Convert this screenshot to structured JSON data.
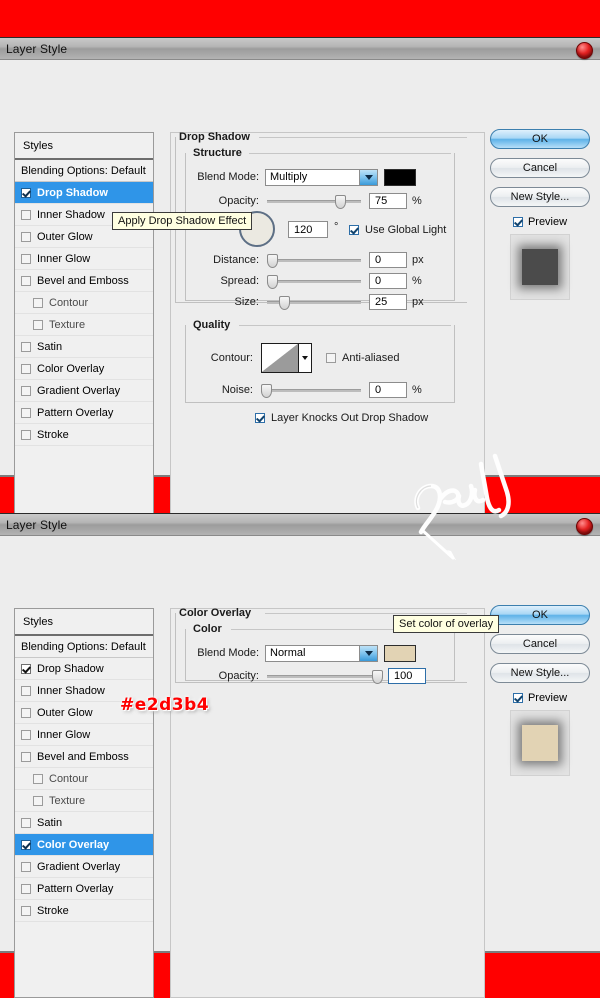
{
  "page": {
    "background_color": "#ff0000",
    "annotation_hex": "#e2d3b4",
    "signature_text": "genial"
  },
  "dialog1": {
    "title": "Layer Style",
    "styles": {
      "header": "Styles",
      "items": [
        {
          "label": "Blending Options: Default",
          "checkbox": false,
          "checked": false,
          "selected": false,
          "sub": false
        },
        {
          "label": "Drop Shadow",
          "checkbox": true,
          "checked": true,
          "selected": true,
          "sub": false
        },
        {
          "label": "Inner Shadow",
          "checkbox": true,
          "checked": false,
          "selected": false,
          "sub": false
        },
        {
          "label": "Outer Glow",
          "checkbox": true,
          "checked": false,
          "selected": false,
          "sub": false
        },
        {
          "label": "Inner Glow",
          "checkbox": true,
          "checked": false,
          "selected": false,
          "sub": false
        },
        {
          "label": "Bevel and Emboss",
          "checkbox": true,
          "checked": false,
          "selected": false,
          "sub": false
        },
        {
          "label": "Contour",
          "checkbox": true,
          "checked": false,
          "selected": false,
          "sub": true
        },
        {
          "label": "Texture",
          "checkbox": true,
          "checked": false,
          "selected": false,
          "sub": true
        },
        {
          "label": "Satin",
          "checkbox": true,
          "checked": false,
          "selected": false,
          "sub": false
        },
        {
          "label": "Color Overlay",
          "checkbox": true,
          "checked": false,
          "selected": false,
          "sub": false
        },
        {
          "label": "Gradient Overlay",
          "checkbox": true,
          "checked": false,
          "selected": false,
          "sub": false
        },
        {
          "label": "Pattern Overlay",
          "checkbox": true,
          "checked": false,
          "selected": false,
          "sub": false
        },
        {
          "label": "Stroke",
          "checkbox": true,
          "checked": false,
          "selected": false,
          "sub": false
        }
      ]
    },
    "panel": {
      "group_title": "Drop Shadow",
      "structure_title": "Structure",
      "blend_mode_label": "Blend Mode:",
      "blend_mode_value": "Multiply",
      "shadow_color": "#000000",
      "opacity_label": "Opacity:",
      "opacity_value": "75",
      "opacity_unit": "%",
      "angle_value": "120",
      "angle_unit": "°",
      "use_global_light_label": "Use Global Light",
      "use_global_light_checked": true,
      "distance_label": "Distance:",
      "distance_value": "0",
      "distance_unit": "px",
      "spread_label": "Spread:",
      "spread_value": "0",
      "spread_unit": "%",
      "size_label": "Size:",
      "size_value": "25",
      "size_unit": "px",
      "quality_title": "Quality",
      "contour_label": "Contour:",
      "antialiased_label": "Anti-aliased",
      "antialiased_checked": false,
      "noise_label": "Noise:",
      "noise_value": "0",
      "noise_unit": "%",
      "knockout_label": "Layer Knocks Out Drop Shadow",
      "knockout_checked": true
    },
    "buttons": {
      "ok": "OK",
      "cancel": "Cancel",
      "new_style": "New Style...",
      "preview": "Preview",
      "preview_checked": true,
      "thumb_color": "#4b4b4b"
    },
    "tooltip": "Apply Drop Shadow Effect"
  },
  "dialog2": {
    "title": "Layer Style",
    "styles": {
      "header": "Styles",
      "items": [
        {
          "label": "Blending Options: Default",
          "checkbox": false,
          "checked": false,
          "selected": false,
          "sub": false
        },
        {
          "label": "Drop Shadow",
          "checkbox": true,
          "checked": true,
          "selected": false,
          "sub": false
        },
        {
          "label": "Inner Shadow",
          "checkbox": true,
          "checked": false,
          "selected": false,
          "sub": false
        },
        {
          "label": "Outer Glow",
          "checkbox": true,
          "checked": false,
          "selected": false,
          "sub": false
        },
        {
          "label": "Inner Glow",
          "checkbox": true,
          "checked": false,
          "selected": false,
          "sub": false
        },
        {
          "label": "Bevel and Emboss",
          "checkbox": true,
          "checked": false,
          "selected": false,
          "sub": false
        },
        {
          "label": "Contour",
          "checkbox": true,
          "checked": false,
          "selected": false,
          "sub": true
        },
        {
          "label": "Texture",
          "checkbox": true,
          "checked": false,
          "selected": false,
          "sub": true
        },
        {
          "label": "Satin",
          "checkbox": true,
          "checked": false,
          "selected": false,
          "sub": false
        },
        {
          "label": "Color Overlay",
          "checkbox": true,
          "checked": true,
          "selected": true,
          "sub": false
        },
        {
          "label": "Gradient Overlay",
          "checkbox": true,
          "checked": false,
          "selected": false,
          "sub": false
        },
        {
          "label": "Pattern Overlay",
          "checkbox": true,
          "checked": false,
          "selected": false,
          "sub": false
        },
        {
          "label": "Stroke",
          "checkbox": true,
          "checked": false,
          "selected": false,
          "sub": false
        }
      ]
    },
    "panel": {
      "group_title": "Color Overlay",
      "color_title": "Color",
      "blend_mode_label": "Blend Mode:",
      "blend_mode_value": "Normal",
      "overlay_color": "#e2d3b4",
      "opacity_label": "Opacity:",
      "opacity_value": "100"
    },
    "buttons": {
      "ok": "OK",
      "cancel": "Cancel",
      "new_style": "New Style...",
      "preview": "Preview",
      "preview_checked": true,
      "thumb_color": "#e2d3b4"
    },
    "tooltip": "Set color of overlay"
  }
}
